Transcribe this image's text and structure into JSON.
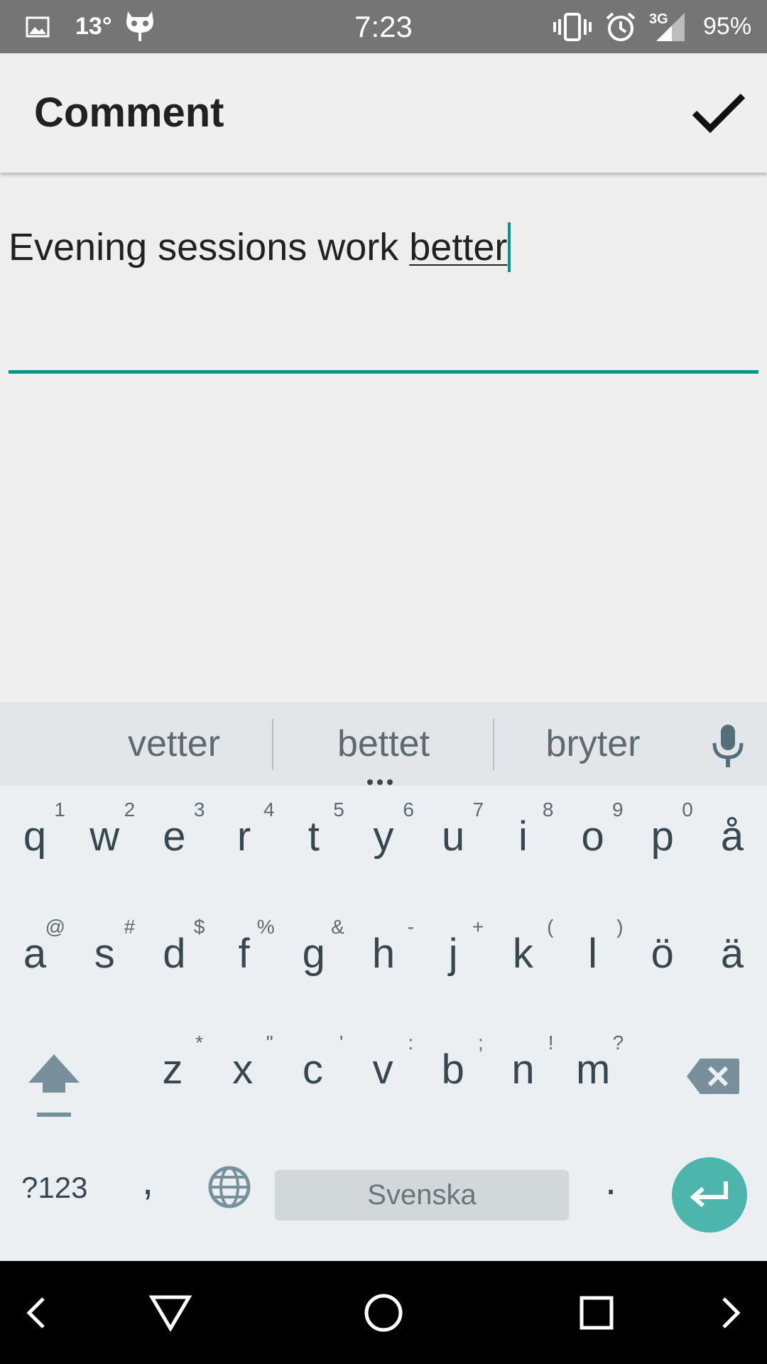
{
  "status_bar": {
    "temperature": "13°",
    "time": "7:23",
    "network": "3G",
    "battery": "95%",
    "icons": [
      "image-icon",
      "cyanogen-mascot-icon",
      "vibrate-icon",
      "alarm-icon",
      "signal-icon"
    ]
  },
  "app_bar": {
    "title": "Comment",
    "confirm_icon": "check-icon"
  },
  "comment": {
    "text_before": "Evening sessions work ",
    "composing_word": "better",
    "accent_color": "#009688"
  },
  "keyboard": {
    "suggestions": [
      "vetter",
      "bettet",
      "bryter"
    ],
    "row1": [
      {
        "key": "q",
        "hint": "1"
      },
      {
        "key": "w",
        "hint": "2"
      },
      {
        "key": "e",
        "hint": "3"
      },
      {
        "key": "r",
        "hint": "4"
      },
      {
        "key": "t",
        "hint": "5"
      },
      {
        "key": "y",
        "hint": "6"
      },
      {
        "key": "u",
        "hint": "7"
      },
      {
        "key": "i",
        "hint": "8"
      },
      {
        "key": "o",
        "hint": "9"
      },
      {
        "key": "p",
        "hint": "0"
      },
      {
        "key": "å",
        "hint": ""
      }
    ],
    "row2": [
      {
        "key": "a",
        "hint": "@"
      },
      {
        "key": "s",
        "hint": "#"
      },
      {
        "key": "d",
        "hint": "$"
      },
      {
        "key": "f",
        "hint": "%"
      },
      {
        "key": "g",
        "hint": "&"
      },
      {
        "key": "h",
        "hint": "-"
      },
      {
        "key": "j",
        "hint": "+"
      },
      {
        "key": "k",
        "hint": "("
      },
      {
        "key": "l",
        "hint": ")"
      },
      {
        "key": "ö",
        "hint": ""
      },
      {
        "key": "ä",
        "hint": ""
      }
    ],
    "row3": [
      {
        "key": "z",
        "hint": "*"
      },
      {
        "key": "x",
        "hint": "\""
      },
      {
        "key": "c",
        "hint": "'"
      },
      {
        "key": "v",
        "hint": ":"
      },
      {
        "key": "b",
        "hint": ";"
      },
      {
        "key": "n",
        "hint": "!"
      },
      {
        "key": "m",
        "hint": "?"
      }
    ],
    "symbols_key": "?123",
    "comma_key": ",",
    "period_key": ".",
    "spacebar_label": "Svenska",
    "enter_color": "#4db6ac"
  },
  "nav_bar": {
    "icons": [
      "chevron-left-icon",
      "back-icon",
      "home-icon",
      "recents-icon",
      "chevron-right-icon"
    ]
  }
}
